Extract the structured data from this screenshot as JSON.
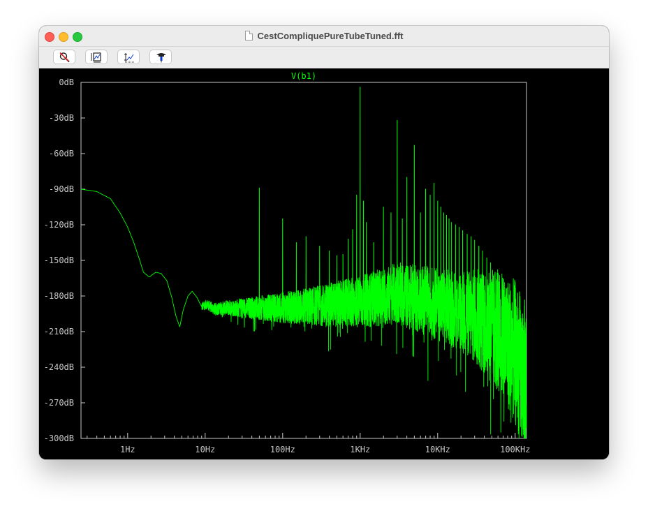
{
  "window": {
    "title": "CestCompliquePureTubeTuned.fft"
  },
  "toolbar": {
    "buttons": [
      {
        "name": "zoom-cancel",
        "icon": "zoom-cancel-icon"
      },
      {
        "name": "autorange",
        "icon": "autorange-icon"
      },
      {
        "name": "autorange-y",
        "icon": "autorange-y-icon"
      },
      {
        "name": "probe",
        "icon": "probe-icon"
      }
    ]
  },
  "chart_data": {
    "type": "line",
    "title": "V(b1)",
    "xscale": "log",
    "xlim": [
      0.25,
      140000
    ],
    "ylim": [
      -300,
      0
    ],
    "x_ticks": [
      "1Hz",
      "10Hz",
      "100Hz",
      "1KHz",
      "10KHz",
      "100KHz"
    ],
    "y_ticks": [
      "0dB",
      "-30dB",
      "-60dB",
      "-90dB",
      "-120dB",
      "-150dB",
      "-180dB",
      "-210dB",
      "-240dB",
      "-270dB",
      "-300dB"
    ],
    "series": [
      {
        "name": "V(b1)",
        "color": "#00ff00",
        "baseline": [
          [
            0.25,
            -90
          ],
          [
            0.4,
            -92
          ],
          [
            0.6,
            -98
          ],
          [
            0.8,
            -110
          ],
          [
            1.0,
            -122
          ],
          [
            1.2,
            -135
          ],
          [
            1.4,
            -148
          ],
          [
            1.6,
            -160
          ],
          [
            1.9,
            -164
          ],
          [
            2.3,
            -160
          ],
          [
            2.7,
            -161
          ],
          [
            3.2,
            -167
          ],
          [
            3.7,
            -181
          ],
          [
            4.2,
            -197
          ],
          [
            4.7,
            -206
          ],
          [
            5.2,
            -192
          ],
          [
            6.0,
            -180
          ],
          [
            6.8,
            -176
          ],
          [
            7.8,
            -181
          ],
          [
            9.0,
            -189
          ],
          [
            10.5,
            -187
          ],
          [
            13,
            -191
          ],
          [
            20,
            -190
          ],
          [
            40,
            -190
          ],
          [
            100,
            -190
          ],
          [
            300,
            -188
          ],
          [
            1000,
            -185
          ],
          [
            3000,
            -178
          ],
          [
            7000,
            -184
          ],
          [
            15000,
            -190
          ],
          [
            30000,
            -197
          ],
          [
            60000,
            -209
          ],
          [
            100000,
            -227
          ],
          [
            130000,
            -248
          ]
        ],
        "peaks": [
          [
            50,
            -89
          ],
          [
            100,
            -115
          ],
          [
            150,
            -135
          ],
          [
            200,
            -130
          ],
          [
            300,
            -138
          ],
          [
            400,
            -142
          ],
          [
            500,
            -146
          ],
          [
            600,
            -145
          ],
          [
            700,
            -132
          ],
          [
            800,
            -124
          ],
          [
            900,
            -95
          ],
          [
            1000,
            -4
          ],
          [
            1100,
            -100
          ],
          [
            1200,
            -118
          ],
          [
            1500,
            -135
          ],
          [
            2000,
            -105
          ],
          [
            2500,
            -110
          ],
          [
            3000,
            -32
          ],
          [
            3500,
            -115
          ],
          [
            4000,
            -80
          ],
          [
            5000,
            -53
          ],
          [
            6000,
            -110
          ],
          [
            7000,
            -90
          ],
          [
            8000,
            -95
          ],
          [
            9000,
            -85
          ],
          [
            10000,
            -100
          ],
          [
            11000,
            -105
          ],
          [
            12000,
            -110
          ],
          [
            13000,
            -112
          ],
          [
            14000,
            -115
          ],
          [
            15000,
            -118
          ],
          [
            17000,
            -120
          ],
          [
            19000,
            -122
          ],
          [
            21000,
            -125
          ],
          [
            24000,
            -128
          ],
          [
            27000,
            -130
          ],
          [
            30000,
            -133
          ],
          [
            34000,
            -138
          ],
          [
            38000,
            -142
          ],
          [
            43000,
            -148
          ],
          [
            48000,
            -152
          ],
          [
            55000,
            -160
          ],
          [
            62000,
            -168
          ],
          [
            70000,
            -175
          ],
          [
            80000,
            -182
          ]
        ]
      }
    ]
  }
}
